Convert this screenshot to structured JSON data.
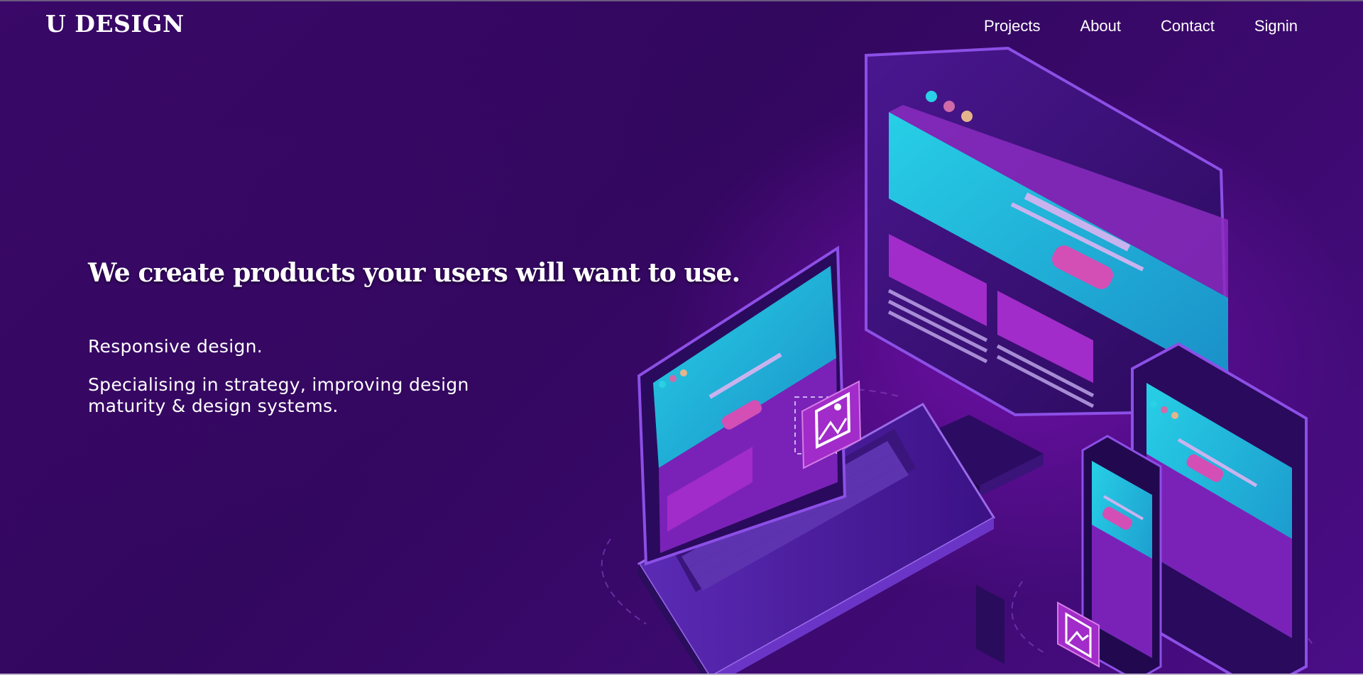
{
  "brand": {
    "logo": "U DESIGN"
  },
  "nav": {
    "items": [
      {
        "label": "Projects"
      },
      {
        "label": "About"
      },
      {
        "label": "Contact"
      },
      {
        "label": "Signin"
      }
    ]
  },
  "hero": {
    "headline": "We create products your users will want to use.",
    "subtitle": "Responsive design.",
    "description": "Specialising in strategy, improving design maturity & design systems."
  },
  "illustration": {
    "icons": [
      "image-icon",
      "image-icon"
    ]
  },
  "colors": {
    "background": "#2f0657",
    "accent_cyan": "#22c7e0",
    "accent_magenta": "#c23ad0",
    "device_purple": "#5a23b8"
  }
}
